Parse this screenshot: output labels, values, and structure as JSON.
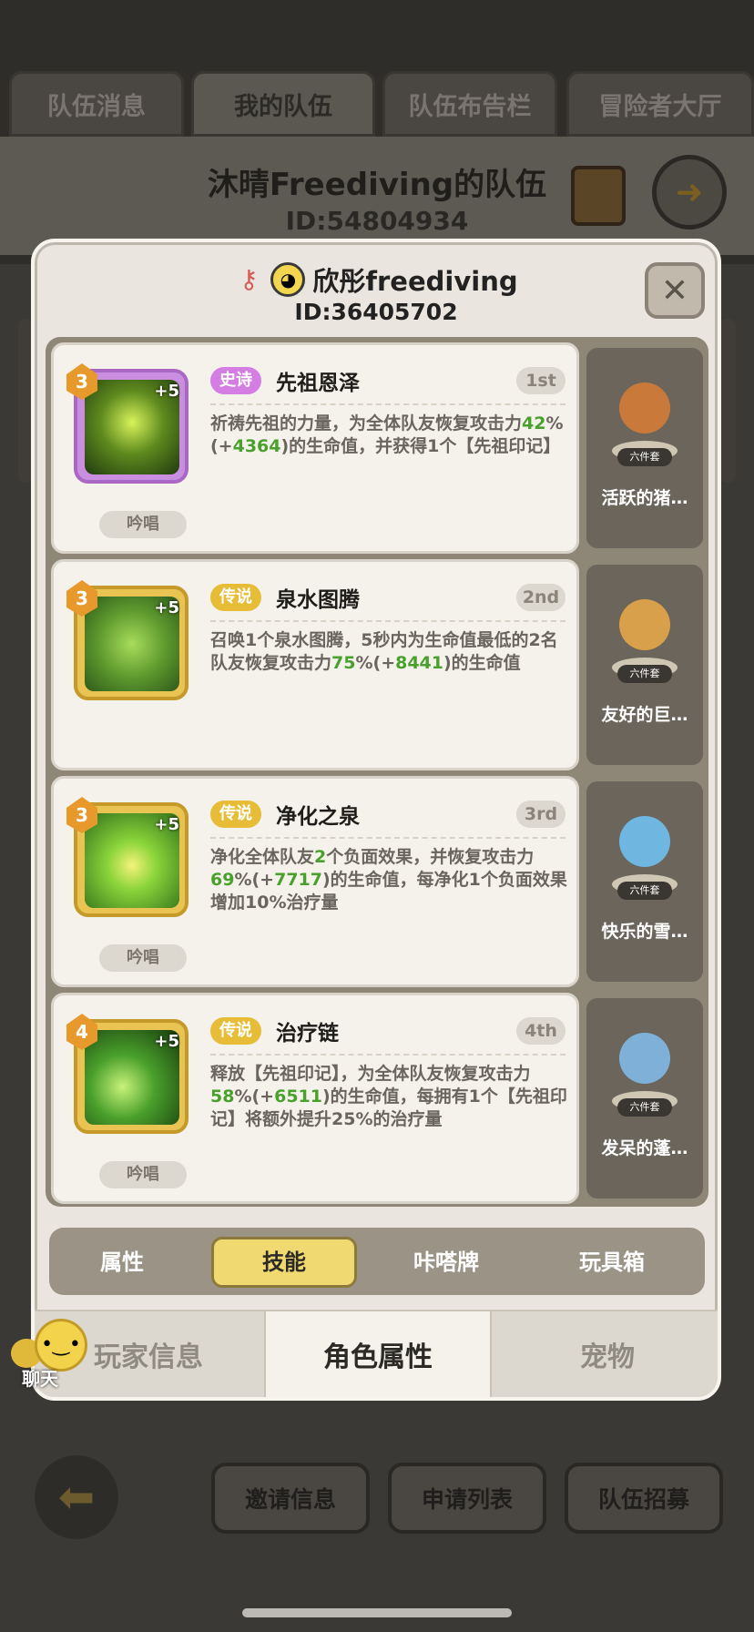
{
  "team_tabs": [
    "队伍消息",
    "我的队伍",
    "队伍布告栏",
    "冒险者大厅"
  ],
  "team": {
    "name": "沐晴Freediving的队伍",
    "id": "ID:54804934"
  },
  "player": {
    "name": "欣彤freediving",
    "id": "ID:36405702"
  },
  "close_glyph": "✕",
  "skills": [
    {
      "level": "3",
      "plus": "+5",
      "rarity": "史诗",
      "name": "先祖恩泽",
      "rank": "1st",
      "chant": "吟唱",
      "desc": [
        "祈祷先祖的力量，为全体队友恢复攻击力",
        "42",
        "%(+",
        "4364",
        ")的生命值，并获得1个【先祖印记】"
      ]
    },
    {
      "level": "3",
      "plus": "+5",
      "rarity": "传说",
      "name": "泉水图腾",
      "rank": "2nd",
      "chant": "",
      "desc": [
        "召唤1个泉水图腾，5秒内为生命值最低的2名队友恢复攻击力",
        "75",
        "%(+",
        "8441",
        ")的生命值"
      ]
    },
    {
      "level": "3",
      "plus": "+5",
      "rarity": "传说",
      "name": "净化之泉",
      "rank": "3rd",
      "chant": "吟唱",
      "desc": [
        "净化全体队友",
        "2",
        "个负面效果，并恢复攻击力",
        "69",
        "%(+",
        "7717",
        ")的生命值，每净化1个负面效果增加10%治疗量"
      ]
    },
    {
      "level": "4",
      "plus": "+5",
      "rarity": "传说",
      "name": "治疗链",
      "rank": "4th",
      "chant": "吟唱",
      "desc": [
        "释放【先祖印记】，为全体队友恢复攻击力",
        "58",
        "%(+",
        "6511",
        ")的生命值，每拥有1个【先祖印记】将额外提升25%的治疗量"
      ]
    }
  ],
  "pets": [
    {
      "name": "活跃的猪…",
      "tag": "六件套",
      "color": "#c97a3a"
    },
    {
      "name": "友好的巨…",
      "tag": "六件套",
      "color": "#d8a04a"
    },
    {
      "name": "快乐的雪…",
      "tag": "六件套",
      "color": "#6fb6e0"
    },
    {
      "name": "发呆的蓬…",
      "tag": "六件套",
      "color": "#7fb0d8"
    }
  ],
  "sub_tabs": [
    "属性",
    "技能",
    "咔嗒牌",
    "玩具箱"
  ],
  "bottom_tabs": [
    "玩家信息",
    "角色属性",
    "宠物"
  ],
  "chat_label": "聊天",
  "actions": [
    "邀请信息",
    "申请列表",
    "队伍招募"
  ],
  "colors": {
    "epic": "#d47ee4",
    "legend": "#e7bd38",
    "highlight": "#4aa02c",
    "active_tab": "#f1d972"
  }
}
